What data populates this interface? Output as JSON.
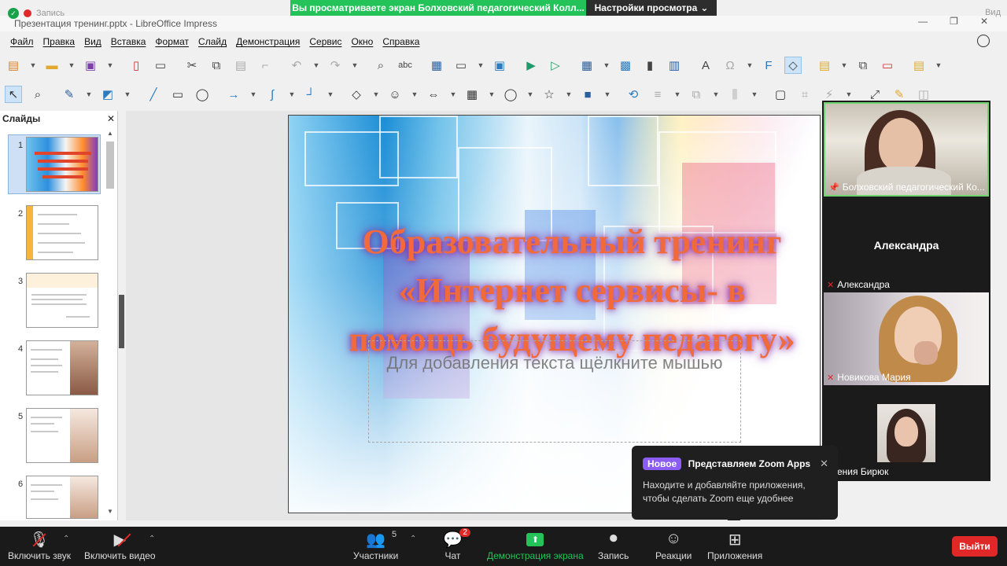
{
  "zoom": {
    "share_banner": "Вы просматриваете экран Болховский педагогический Колл...",
    "view_settings": "Настройки просмотра",
    "recording_label": "Запись",
    "bar": {
      "unmute": "Включить звук",
      "start_video": "Включить видео",
      "participants": "Участники",
      "participants_count": "5",
      "chat": "Чат",
      "chat_badge": "2",
      "share_screen": "Демонстрация экрана",
      "record": "Запись",
      "reactions": "Реакции",
      "apps": "Приложения",
      "leave": "Выйти"
    },
    "videos": [
      {
        "name": "Болховский педагогический Ко..."
      },
      {
        "name": "Александра",
        "center": "Александра"
      },
      {
        "name": "Новикова Мария"
      },
      {
        "name": "Ксения Бирюк"
      }
    ],
    "popup": {
      "badge": "Новое",
      "title": "Представляем Zoom Apps",
      "body": "Находите и добавляйте приложения, чтобы сделать Zoom еще удобнее"
    },
    "top_right_label": "Вид"
  },
  "impress": {
    "window_title": "Презентация тренинг.pptx - LibreOffice Impress",
    "menu": [
      "Файл",
      "Правка",
      "Вид",
      "Вставка",
      "Формат",
      "Слайд",
      "Демонстрация",
      "Сервис",
      "Окно",
      "Справка"
    ],
    "slides_pane_title": "Слайды",
    "slide_numbers": [
      "1",
      "2",
      "3",
      "4",
      "5",
      "6"
    ],
    "slide": {
      "title": "Образовательный тренинг «Интернет сервисы- в помощь будущему педагогу»",
      "placeholder": "Для добавления текста щёлкните мышью"
    }
  },
  "colors": {
    "zoom_green": "#23c35a",
    "leave_red": "#e02828",
    "title_orange": "#f06a3c"
  }
}
